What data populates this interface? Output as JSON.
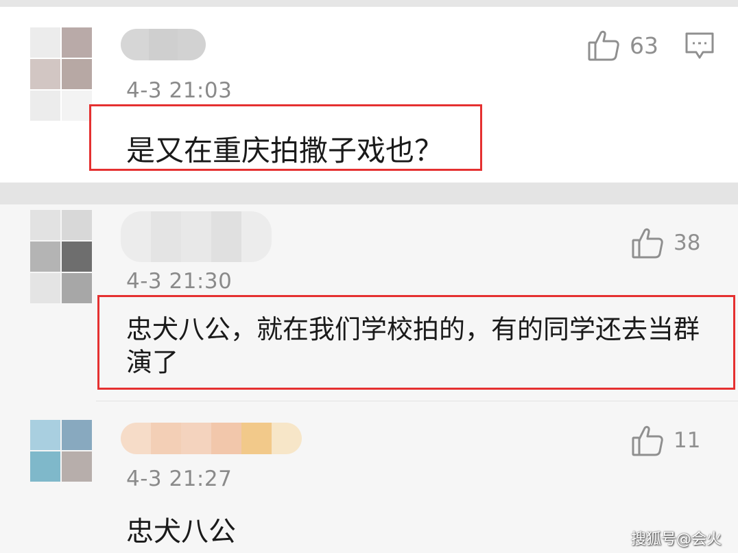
{
  "comments": [
    {
      "time": "4-3 21:03",
      "likes": "63",
      "text": "是又在重庆拍撒子戏也？",
      "highlighted": true,
      "avatar_colors": [
        "#ececec",
        "#b9aaa8",
        "#d2c6c3",
        "#b7a8a4",
        "#ececec",
        "#f3f3f3"
      ],
      "name_blur_colors": [
        "#d6d6d6",
        "#cfcfcf",
        "#d2d2d2"
      ]
    },
    {
      "time": "4-3 21:30",
      "likes": "38",
      "text": "忠犬八公，就在我们学校拍的，有的同学还去当群演了",
      "highlighted": true,
      "avatar_colors": [
        "#e2e2e2",
        "#d8d8d8",
        "#b4b4b4",
        "#6e6e6e",
        "#e4e4e4",
        "#a7a7a7"
      ],
      "name_blur_colors": [
        "#ececec",
        "#e4e4e4",
        "#e8e8e8",
        "#e0e0e0",
        "#ececec"
      ]
    },
    {
      "time": "4-3 21:27",
      "likes": "11",
      "text": "忠犬八公",
      "highlighted": false,
      "avatar_colors": [
        "#a9cfe0",
        "#88a9bf",
        "#7fb8ca",
        "#b7aeab"
      ],
      "name_blur_colors": [
        "#f6dcc8",
        "#f3cfb6",
        "#f4d3be",
        "#f2c7ab",
        "#f2c98a",
        "#f7e6c8"
      ]
    }
  ],
  "icons": {
    "like": "thumbs-up-icon",
    "reply": "comment-reply-icon"
  },
  "colors": {
    "highlight_border": "#e53030",
    "meta_text": "#8a8a8a",
    "comment_text": "#1a1a1a"
  },
  "watermark": "搜狐号@会火"
}
